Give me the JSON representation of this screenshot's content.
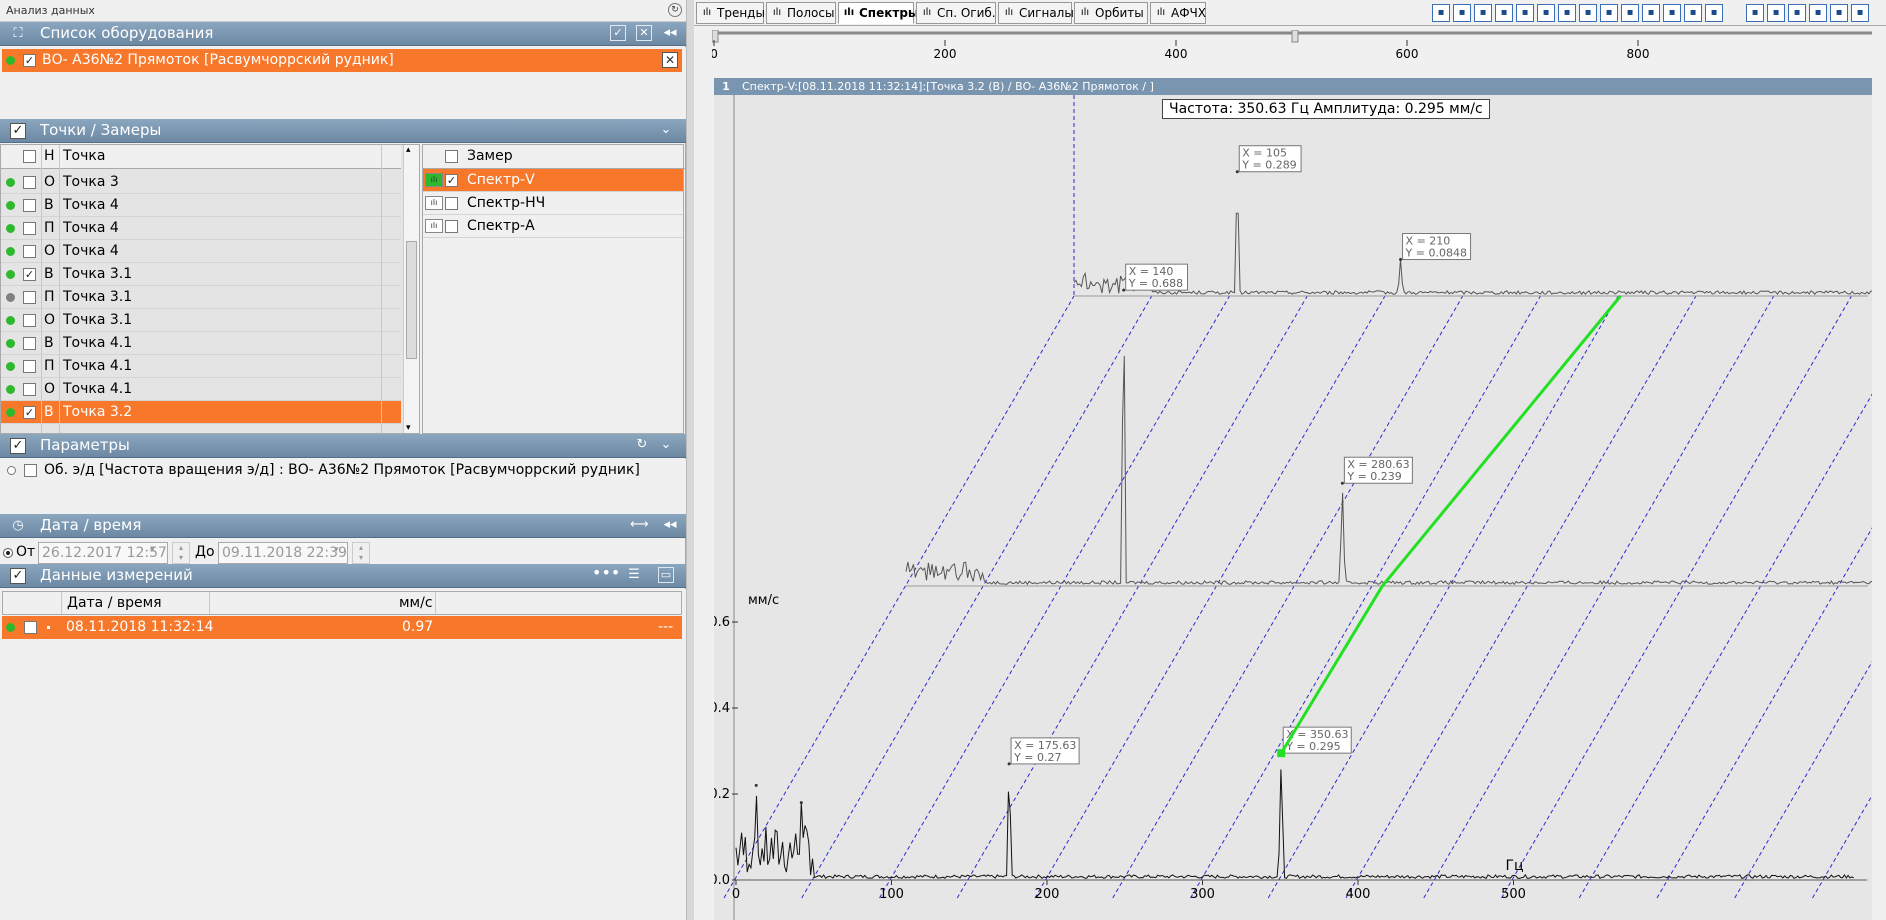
{
  "window": {
    "title": "Анализ данных"
  },
  "equipment": {
    "header": "Список оборудования",
    "items": [
      {
        "label": "ВО- А36№2 Прямоток [Расвумчоррский рудник]",
        "checked": true
      }
    ]
  },
  "points": {
    "header": "Точки / Замеры",
    "columns": {
      "dir": "Н",
      "point": "Точка"
    },
    "partial_row": {
      "dir": "Н",
      "point": "Точка 3"
    },
    "rows": [
      {
        "dir": "О",
        "point": "Точка 3",
        "status": "green",
        "checked": false
      },
      {
        "dir": "В",
        "point": "Точка 4",
        "status": "green",
        "checked": false
      },
      {
        "dir": "П",
        "point": "Точка 4",
        "status": "green",
        "checked": false
      },
      {
        "dir": "О",
        "point": "Точка 4",
        "status": "green",
        "checked": false
      },
      {
        "dir": "В",
        "point": "Точка 3.1",
        "status": "green",
        "checked": true
      },
      {
        "dir": "П",
        "point": "Точка 3.1",
        "status": "gray",
        "checked": false
      },
      {
        "dir": "О",
        "point": "Точка 3.1",
        "status": "green",
        "checked": false
      },
      {
        "dir": "В",
        "point": "Точка 4.1",
        "status": "green",
        "checked": false
      },
      {
        "dir": "П",
        "point": "Точка 4.1",
        "status": "green",
        "checked": false
      },
      {
        "dir": "О",
        "point": "Точка 4.1",
        "status": "green",
        "checked": false
      },
      {
        "dir": "В",
        "point": "Точка 3.2",
        "status": "green",
        "checked": true,
        "selected": true
      }
    ],
    "measure_header": "Замер",
    "measures": [
      {
        "label": "Спектр-V",
        "checked": true,
        "selected": true
      },
      {
        "label": "Спектр-НЧ",
        "checked": false
      },
      {
        "label": "Спектр-А",
        "checked": false
      }
    ]
  },
  "params": {
    "header": "Параметры",
    "items": [
      {
        "label": "Об. э/д [Частота вращения э/д] : ВО- А36№2 Прямоток [Расвумчоррский рудник]"
      }
    ]
  },
  "datetime": {
    "header": "Дата / время",
    "from_label": "От",
    "from_value": "26.12.2017 12:57",
    "to_label": "До",
    "to_value": "09.11.2018 22:39"
  },
  "measurements": {
    "header": "Данные измерений",
    "columns": {
      "datetime": "Дата / время",
      "value": "мм/с"
    },
    "rows": [
      {
        "datetime": "08.11.2018 11:32:14",
        "value": "0.97",
        "extra": "---"
      }
    ]
  },
  "tabs": [
    {
      "label": "Тренды",
      "icon": "trend-icon"
    },
    {
      "label": "Полосы",
      "icon": "bars-icon"
    },
    {
      "label": "Спектры",
      "icon": "spectrum-icon",
      "active": true
    },
    {
      "label": "Сп. Огиб.",
      "icon": "envelope-icon"
    },
    {
      "label": "Сигналы",
      "icon": "signal-icon"
    },
    {
      "label": "Орбиты",
      "icon": "orbit-icon"
    },
    {
      "label": "АФЧХ",
      "icon": "afc-icon"
    }
  ],
  "scale": {
    "ticks": [
      "0",
      "200",
      "400",
      "600",
      "800"
    ]
  },
  "chart_title": {
    "num": "1",
    "text": "Спектр-V:[08.11.2018 11:32:14]:[Точка 3.2 (В) / ВО- А36№2 Прямоток / ]"
  },
  "readout": "Частота: 350.63 Гц  Амплитуда: 0.295 мм/с",
  "chart_data": {
    "type": "line",
    "title": "Спектр-V:[08.11.2018 11:32:14]:[Точка 3.2 (В) / ВО- А36№2 Прямоток / ]",
    "xlabel": "Гц",
    "ylabel": "мм/с",
    "xlim": [
      0,
      720
    ],
    "ylim": [
      0,
      0.7
    ],
    "x_ticks": [
      "0",
      "100",
      "200",
      "300",
      "400",
      "500"
    ],
    "y_ticks": [
      "0.0",
      "0.2",
      "0.4",
      "0.6"
    ],
    "waterfall": true,
    "series": [
      {
        "peaks": [
          {
            "x": 13,
            "y": 0.22
          },
          {
            "x": 42,
            "y": 0.18
          },
          {
            "x": 175.63,
            "y": 0.27
          },
          {
            "x": 350.63,
            "y": 0.295
          }
        ],
        "labels": [
          {
            "text": "X = 175.63\nY = 0.27",
            "x": 175.63,
            "y": 0.27
          },
          {
            "text": "X = 350.63\nY = 0.295",
            "x": 350.63,
            "y": 0.295
          }
        ]
      },
      {
        "peaks": [
          {
            "x": 140,
            "y": 0.688
          },
          {
            "x": 280.63,
            "y": 0.239
          }
        ],
        "labels": [
          {
            "text": "X = 140\nY = 0.688",
            "x": 140,
            "y": 0.688
          },
          {
            "text": "X = 280.63\nY = 0.239",
            "x": 280.63,
            "y": 0.239
          }
        ]
      },
      {
        "peaks": [
          {
            "x": 105,
            "y": 0.289
          },
          {
            "x": 210,
            "y": 0.0848
          }
        ],
        "labels": [
          {
            "text": "X = 105\nY = 0.289",
            "x": 105,
            "y": 0.289
          },
          {
            "text": "X = 210\nY = 0.0848",
            "x": 210,
            "y": 0.0848
          }
        ]
      }
    ],
    "marker": {
      "x": 350.63,
      "y": 0.295
    },
    "grid": false
  },
  "colors": {
    "accent": "#f7772b",
    "header": "#7a95b0",
    "marker": "#22e022",
    "series": "#555555",
    "diag": "#2a2ad0"
  }
}
